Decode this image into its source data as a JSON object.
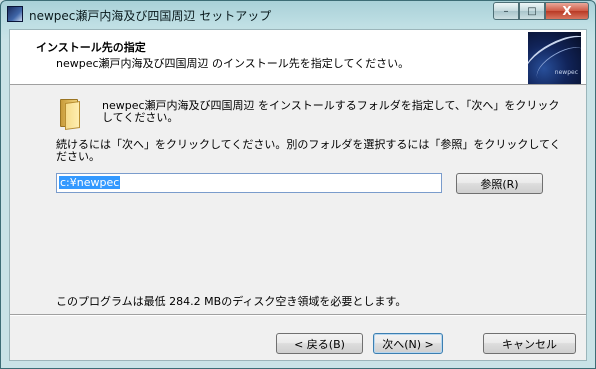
{
  "window": {
    "title": "newpec瀬戸内海及び四国周辺 セットアップ",
    "controls": {
      "minimize": "–",
      "maximize": "□",
      "close": "X"
    }
  },
  "header": {
    "title": "インストール先の指定",
    "subtitle": "newpec瀬戸内海及び四国周辺 のインストール先を指定してください。",
    "logo_text": "newpec"
  },
  "body": {
    "folder_icon": "folder-icon",
    "description": "newpec瀬戸内海及び四国周辺 をインストールするフォルダを指定して、「次へ」をクリックしてください。",
    "instruction": "続けるには「次へ」をクリックしてください。別のフォルダを選択するには「参照」をクリックしてください。",
    "install_path": "c:¥newpec",
    "browse_label": "参照(R)",
    "space_required": "このプログラムは最低 284.2 MBのディスク空き領域を必要とします。"
  },
  "footer": {
    "back_label": "< 戻る(B)",
    "next_label": "次へ(N) >",
    "cancel_label": "キャンセル"
  }
}
